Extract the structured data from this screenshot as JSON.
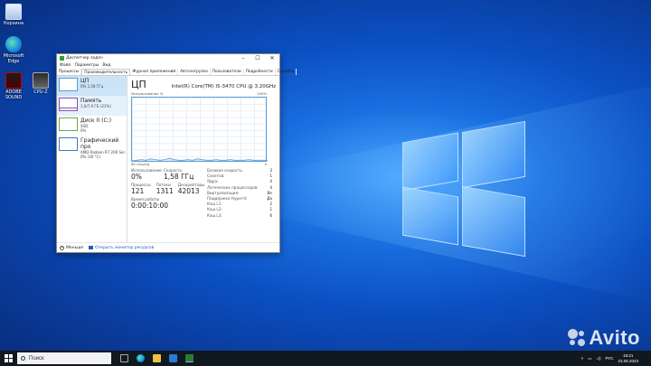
{
  "desktop": {
    "icons": [
      {
        "label": "Корзина"
      },
      {
        "label": "Microsoft Edge"
      },
      {
        "label": "ADOBE SOUND"
      },
      {
        "label": "CPU-Z"
      }
    ]
  },
  "taskmanager": {
    "title": "Диспетчер задач",
    "menu": [
      "Файл",
      "Параметры",
      "Вид"
    ],
    "tabs": [
      "Процессы",
      "Производительность",
      "Журнал приложений",
      "Автозагрузка",
      "Пользователи",
      "Подробности",
      "Службы"
    ],
    "active_tab": "Производительность",
    "sidebar": [
      {
        "name": "ЦП",
        "detail": "0% 1,58 ГГц"
      },
      {
        "name": "Память",
        "detail": "1,6/7,9 ГБ (21%)"
      },
      {
        "name": "Диск 0 (C:)",
        "detail": "SSD",
        "detail2": "0%"
      },
      {
        "name": "Графический про",
        "detail": "AMD Radeon R7 200 Ser",
        "detail2": "0% (30 °C)"
      }
    ],
    "cpu": {
      "title": "ЦП",
      "model": "Intel(R) Core(TM) i5-3470 CPU @ 3.20GHz",
      "usage_label": "Использование %",
      "usage_max": "100%",
      "time_label": "60 секунд",
      "time_min": "0",
      "graph_values": [
        0,
        1,
        2,
        1,
        3,
        2,
        1,
        2,
        4,
        2,
        1,
        1,
        2,
        1,
        3,
        2,
        1,
        1,
        2,
        1,
        1,
        2,
        1,
        1,
        1,
        2,
        1,
        1,
        1,
        1
      ],
      "stats": {
        "usage_k": "Использование",
        "usage_v": "0%",
        "speed_k": "Скорость",
        "speed_v": "1,58 ГГц",
        "proc_k": "Процессы",
        "proc_v": "121",
        "threads_k": "Потоки",
        "threads_v": "1311",
        "handles_k": "Дескрипторы",
        "handles_v": "42013",
        "uptime_k": "Время работы",
        "uptime_v": "0:00:10:00"
      },
      "details": [
        {
          "k": "Базовая скорость",
          "v": "3"
        },
        {
          "k": "Сокетов:",
          "v": "1"
        },
        {
          "k": "Ядра:",
          "v": "4"
        },
        {
          "k": "Логических процессоров:",
          "v": "4"
        },
        {
          "k": "Виртуализация:",
          "v": "Ве"
        },
        {
          "k": "Поддержка Hyper-V:",
          "v": "Да"
        },
        {
          "k": "Кэш L1:",
          "v": "2"
        },
        {
          "k": "Кэш L2:",
          "v": "1"
        },
        {
          "k": "Кэш L3:",
          "v": "6"
        }
      ]
    },
    "footer": {
      "less": "Меньше",
      "monitor": "Открыть монитор ресурсов"
    }
  },
  "taskbar": {
    "search_placeholder": "Поиск",
    "lang": "РУС",
    "time": "18:21",
    "date": "23.08.2023"
  },
  "watermark": "Avito",
  "colors": {
    "accent": "#1a5fb4",
    "graph_line": "#5b9bd5",
    "selected_bg": "#cce4f7"
  }
}
